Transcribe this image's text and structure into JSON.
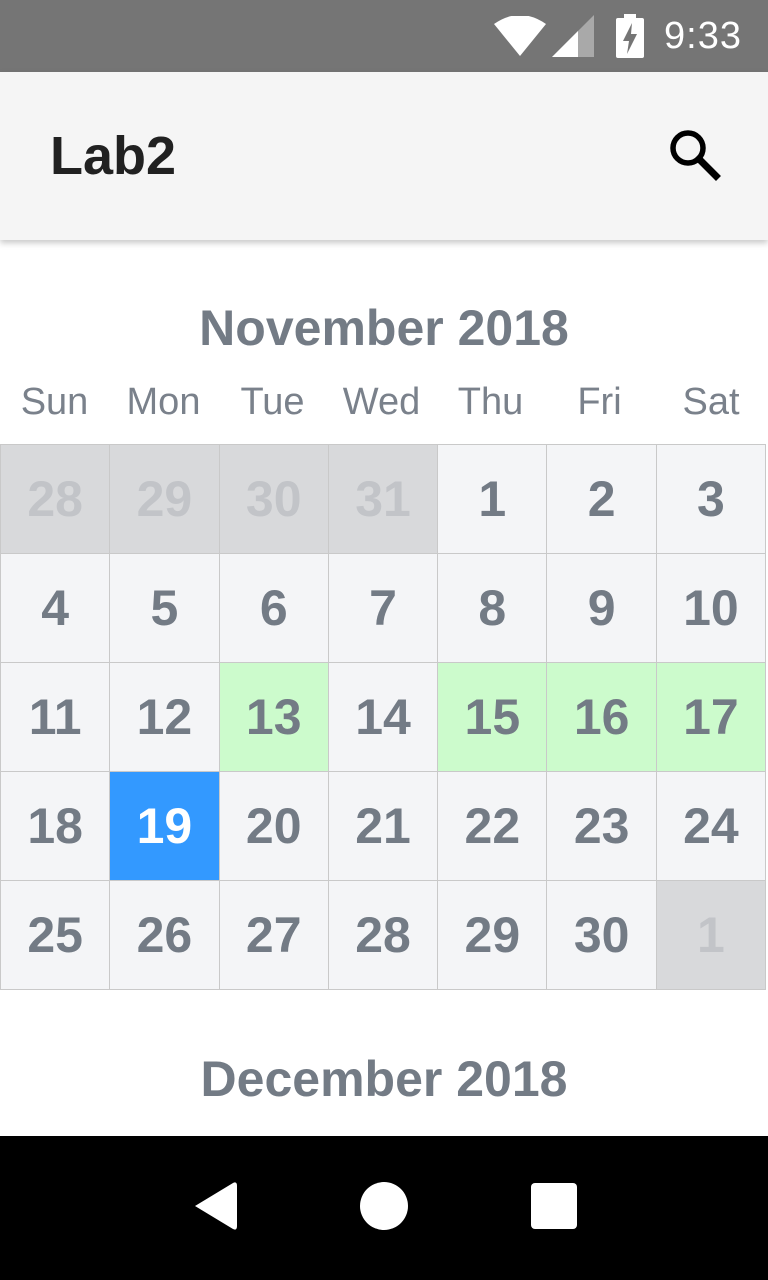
{
  "status_bar": {
    "time": "9:33",
    "icons": [
      "wifi-icon",
      "cell-signal-icon",
      "battery-charging-icon"
    ]
  },
  "app_bar": {
    "title": "Lab2",
    "actions": [
      "search-icon"
    ]
  },
  "calendar": {
    "weekdays": [
      "Sun",
      "Mon",
      "Tue",
      "Wed",
      "Thu",
      "Fri",
      "Sat"
    ],
    "months": [
      {
        "title": "November 2018",
        "weeks": [
          [
            {
              "day": "28",
              "state": "other"
            },
            {
              "day": "29",
              "state": "other"
            },
            {
              "day": "30",
              "state": "other"
            },
            {
              "day": "31",
              "state": "other"
            },
            {
              "day": "1",
              "state": "normal"
            },
            {
              "day": "2",
              "state": "normal"
            },
            {
              "day": "3",
              "state": "normal"
            }
          ],
          [
            {
              "day": "4",
              "state": "normal"
            },
            {
              "day": "5",
              "state": "normal"
            },
            {
              "day": "6",
              "state": "normal"
            },
            {
              "day": "7",
              "state": "normal"
            },
            {
              "day": "8",
              "state": "normal"
            },
            {
              "day": "9",
              "state": "normal"
            },
            {
              "day": "10",
              "state": "normal"
            }
          ],
          [
            {
              "day": "11",
              "state": "normal"
            },
            {
              "day": "12",
              "state": "normal"
            },
            {
              "day": "13",
              "state": "event"
            },
            {
              "day": "14",
              "state": "normal"
            },
            {
              "day": "15",
              "state": "event"
            },
            {
              "day": "16",
              "state": "event"
            },
            {
              "day": "17",
              "state": "event"
            }
          ],
          [
            {
              "day": "18",
              "state": "normal"
            },
            {
              "day": "19",
              "state": "today"
            },
            {
              "day": "20",
              "state": "normal"
            },
            {
              "day": "21",
              "state": "normal"
            },
            {
              "day": "22",
              "state": "normal"
            },
            {
              "day": "23",
              "state": "normal"
            },
            {
              "day": "24",
              "state": "normal"
            }
          ],
          [
            {
              "day": "25",
              "state": "normal"
            },
            {
              "day": "26",
              "state": "normal"
            },
            {
              "day": "27",
              "state": "normal"
            },
            {
              "day": "28",
              "state": "normal"
            },
            {
              "day": "29",
              "state": "normal"
            },
            {
              "day": "30",
              "state": "normal"
            },
            {
              "day": "1",
              "state": "other"
            }
          ]
        ]
      },
      {
        "title": "December 2018"
      }
    ]
  },
  "colors": {
    "status_bar": "#757575",
    "app_bar": "#f5f5f5",
    "cell_default": "#f4f5f7",
    "cell_other_month": "#d8d9db",
    "cell_event": "#ccfbcc",
    "cell_today": "#3399ff",
    "text_muted": "#737b85"
  },
  "nav_bar": {
    "buttons": [
      "back-icon",
      "home-icon",
      "recents-icon"
    ]
  }
}
